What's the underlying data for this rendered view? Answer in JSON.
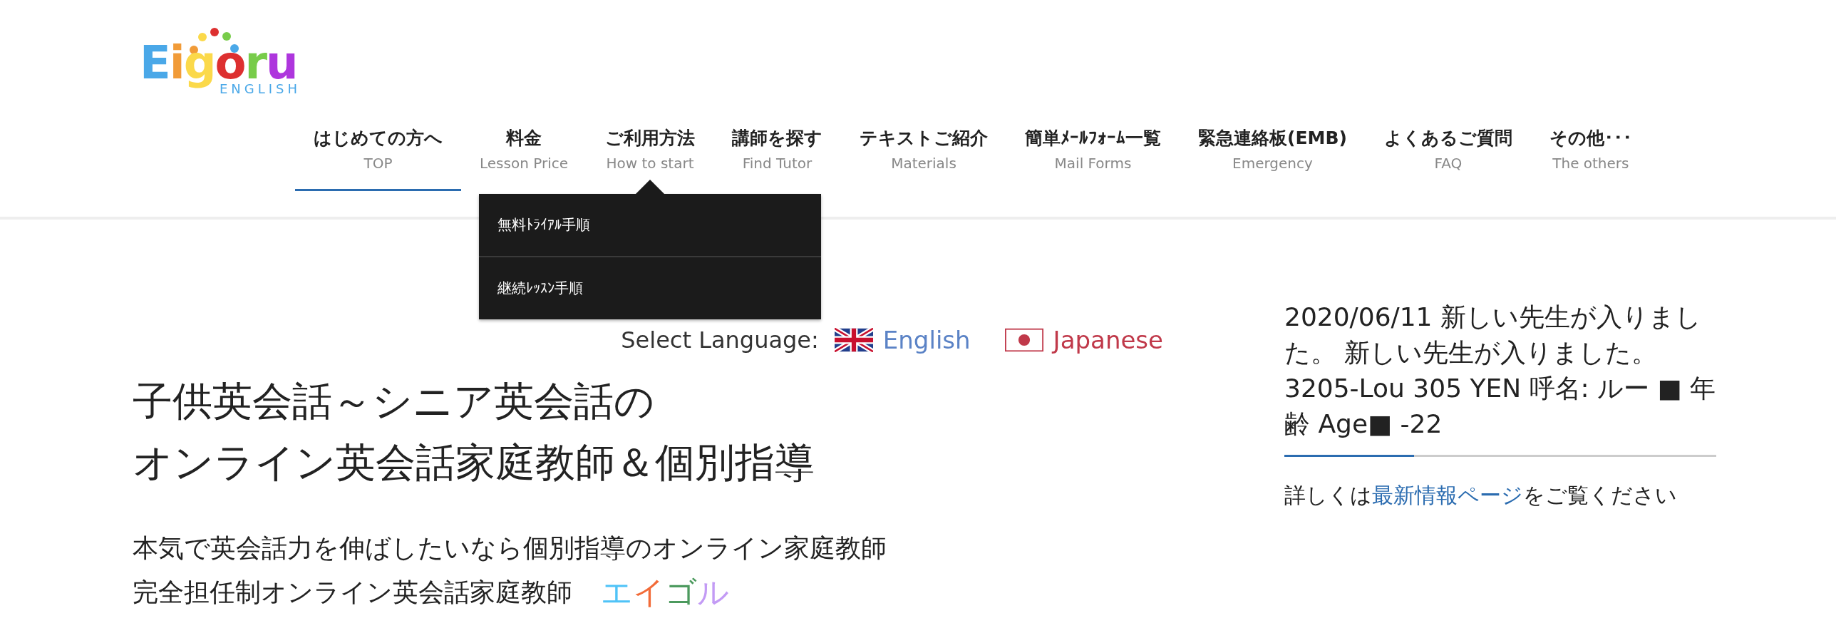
{
  "logo": {
    "letters": [
      {
        "char": "E",
        "color": "#4aa8e8"
      },
      {
        "char": "i",
        "color": "#f19b38"
      },
      {
        "char": "g",
        "color": "#fbd94a"
      },
      {
        "char": "o",
        "color": "#dd3030"
      },
      {
        "char": "r",
        "color": "#78cc4a"
      },
      {
        "char": "u",
        "color": "#ae36dd"
      }
    ],
    "subtitle": "ENGLISH"
  },
  "nav": [
    {
      "label": "はじめての方へ",
      "sub": "TOP",
      "selected": true
    },
    {
      "label": "料金",
      "sub": "Lesson Price",
      "selected": false
    },
    {
      "label": "ご利用方法",
      "sub": "How to start",
      "selected": false,
      "dropdown": [
        "無料ﾄﾗｲｱﾙ手順",
        "継続ﾚｯｽﾝ手順"
      ]
    },
    {
      "label": "講師を探す",
      "sub": "Find Tutor",
      "selected": false
    },
    {
      "label": "テキストご紹介",
      "sub": "Materials",
      "selected": false
    },
    {
      "label": "簡単ﾒｰﾙﾌｫｰﾑ一覧",
      "sub": "Mail Forms",
      "selected": false
    },
    {
      "label": "緊急連絡板(EMB)",
      "sub": "Emergency",
      "selected": false
    },
    {
      "label": "よくあるご質問",
      "sub": "FAQ",
      "selected": false
    },
    {
      "label": "その他･･･",
      "sub": "The others",
      "selected": false
    }
  ],
  "language": {
    "label": "Select Language:",
    "options": [
      {
        "kind": "uk",
        "label": "English"
      },
      {
        "kind": "jp",
        "label": "Japanese"
      }
    ]
  },
  "heading": [
    "子供英会話～シニア英会話の",
    "オンライン英会話家庭教師＆個別指導"
  ],
  "intro": {
    "lines": [
      "本気で英会話力を伸ばしたいなら個別指導のオンライン家庭教師",
      "完全担任制オンライン英会話家庭教師"
    ],
    "brand": [
      {
        "char": "エ",
        "color": "#4fc3f7"
      },
      {
        "char": "イ",
        "color": "#f26b38"
      },
      {
        "char": "ゴ",
        "color": "#4c9a5e"
      },
      {
        "char": "ル",
        "color": "#c39bf5"
      }
    ]
  },
  "news": {
    "text": "2020/06/11 新しい先生が入りました。 新しい先生が入りました。 3205-Lou 305 YEN 呼名: ルー ■ 年齢 Age■ -22",
    "more_prefix": "詳しくは",
    "more_link": "最新情報ページ",
    "more_suffix": "をご覧ください"
  }
}
